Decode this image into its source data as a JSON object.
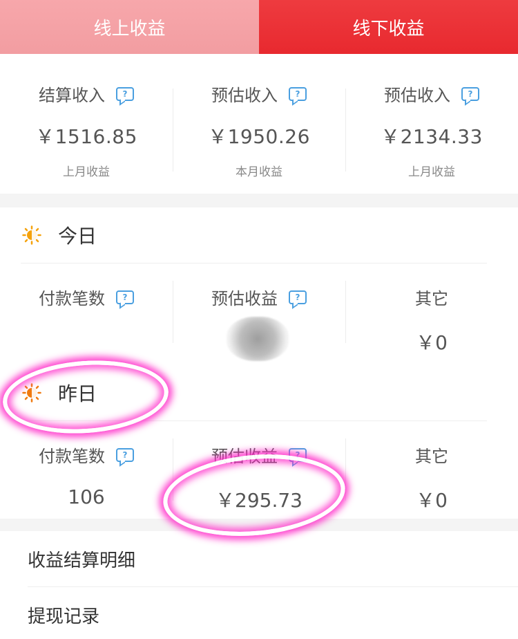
{
  "tabs": [
    {
      "label": "线上收益",
      "active": false
    },
    {
      "label": "线下收益",
      "active": true
    }
  ],
  "summary": [
    {
      "label": "结算收入",
      "amount": "￥1516.85",
      "sub": "上月收益"
    },
    {
      "label": "预估收入",
      "amount": "￥1950.26",
      "sub": "本月收益"
    },
    {
      "label": "预估收入",
      "amount": "￥2134.33",
      "sub": "上月收益"
    }
  ],
  "today": {
    "title": "今日",
    "stats": [
      {
        "label": "付款笔数",
        "value": ""
      },
      {
        "label": "预估收益",
        "value": ""
      },
      {
        "label": "其它",
        "value": "￥0"
      }
    ]
  },
  "yesterday": {
    "title": "昨日",
    "stats": [
      {
        "label": "付款笔数",
        "value": "106"
      },
      {
        "label": "预估收益",
        "value": "￥295.73"
      },
      {
        "label": "其它",
        "value": "￥0"
      }
    ]
  },
  "menu": [
    {
      "label": "收益结算明细"
    },
    {
      "label": "提现记录"
    }
  ],
  "colors": {
    "tab_inactive": "#f29da1",
    "tab_active": "#e8292f",
    "help_icon": "#4a9fe0",
    "sun_icon": "#f5a20b",
    "highlight": "#ff28c8"
  },
  "icons": {
    "help": "question-bubble-icon",
    "sun": "sun-icon"
  }
}
